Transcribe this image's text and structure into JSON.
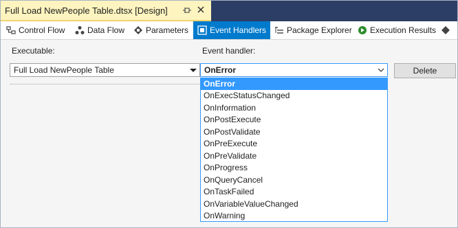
{
  "document_tab": {
    "title": "Full Load NewPeople Table.dtsx [Design]"
  },
  "designer_tabs": [
    {
      "label": "Control Flow"
    },
    {
      "label": "Data Flow"
    },
    {
      "label": "Parameters"
    },
    {
      "label": "Event Handlers",
      "active": true
    },
    {
      "label": "Package Explorer"
    },
    {
      "label": "Execution Results"
    }
  ],
  "executable": {
    "label": "Executable:",
    "value": "Full Load NewPeople Table"
  },
  "event_handler": {
    "label": "Event handler:",
    "value": "OnError",
    "options": [
      "OnError",
      "OnExecStatusChanged",
      "OnInformation",
      "OnPostExecute",
      "OnPostValidate",
      "OnPreExecute",
      "OnPreValidate",
      "OnProgress",
      "OnQueryCancel",
      "OnTaskFailed",
      "OnVariableValueChanged",
      "OnWarning"
    ],
    "selected_option": "OnError"
  },
  "delete_button": {
    "label": "Delete"
  },
  "colors": {
    "tab_strip": "#2c3e66",
    "document_tab": "#fdf4bf",
    "active_tab": "#007acc",
    "selection": "#3399ff"
  },
  "icons": {
    "control_flow": "control-flow-icon",
    "data_flow": "data-flow-icon",
    "parameters": "parameters-icon",
    "event_handlers": "event-handlers-icon",
    "package_explorer": "package-explorer-icon",
    "execution_results": "execution-results-icon",
    "pin": "pin-icon",
    "close": "close-icon"
  }
}
